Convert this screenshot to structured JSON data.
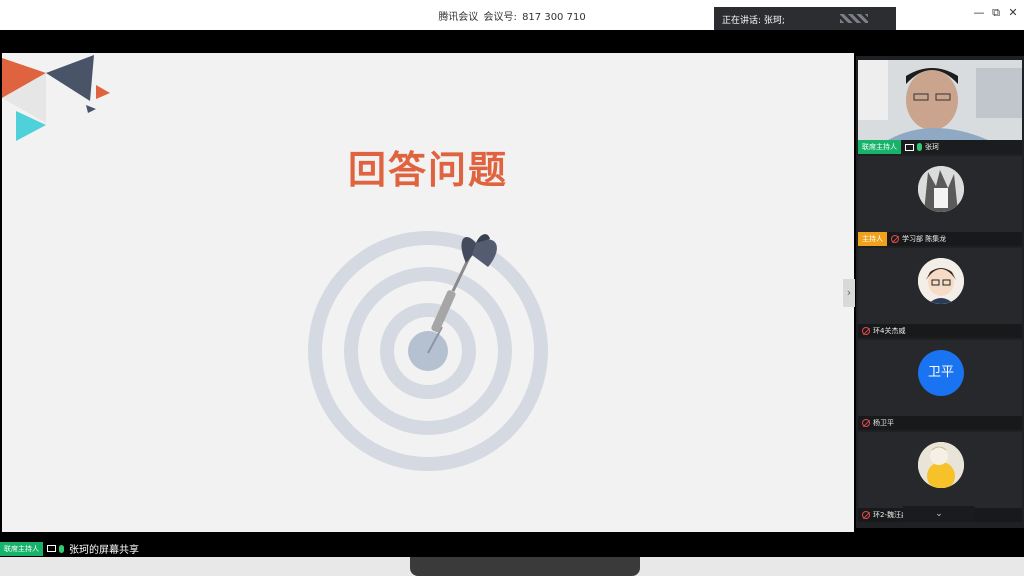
{
  "titlebar": {
    "app_name": "腾讯会议",
    "meeting_label": "会议号:",
    "meeting_id": "817 300 710"
  },
  "speaking": {
    "label": "正在讲话:",
    "name": "张珂;"
  },
  "window_controls": {
    "minimize": "—",
    "restore": "⧉",
    "close": "✕"
  },
  "slide": {
    "title": "回答问题"
  },
  "participants": [
    {
      "role": "联席主持人",
      "name": "张珂",
      "mic": "on",
      "sharing": true,
      "avatar": "video"
    },
    {
      "role": "主持人",
      "name": "学习部 陈集龙",
      "mic": "off",
      "sharing": false,
      "avatar": "manga"
    },
    {
      "role": "",
      "name": "环4关杰威",
      "mic": "off",
      "sharing": false,
      "avatar": "cartoon"
    },
    {
      "role": "",
      "name": "杨卫平",
      "mic": "off",
      "sharing": false,
      "avatar": "text",
      "avatar_text": "卫平"
    },
    {
      "role": "",
      "name": "环2-魏汪淼",
      "mic": "off",
      "sharing": false,
      "avatar": "yellow"
    }
  ],
  "bottombar": {
    "role": "联席主持人",
    "share_text": "张珂的屏幕共享"
  },
  "panel_toggle": "›",
  "scroll_indicator": "⌄",
  "colors": {
    "accent_green": "#17b36a",
    "host_orange": "#f1a21d",
    "title_orange": "#e0633f",
    "avatar_blue": "#1a73f0"
  }
}
